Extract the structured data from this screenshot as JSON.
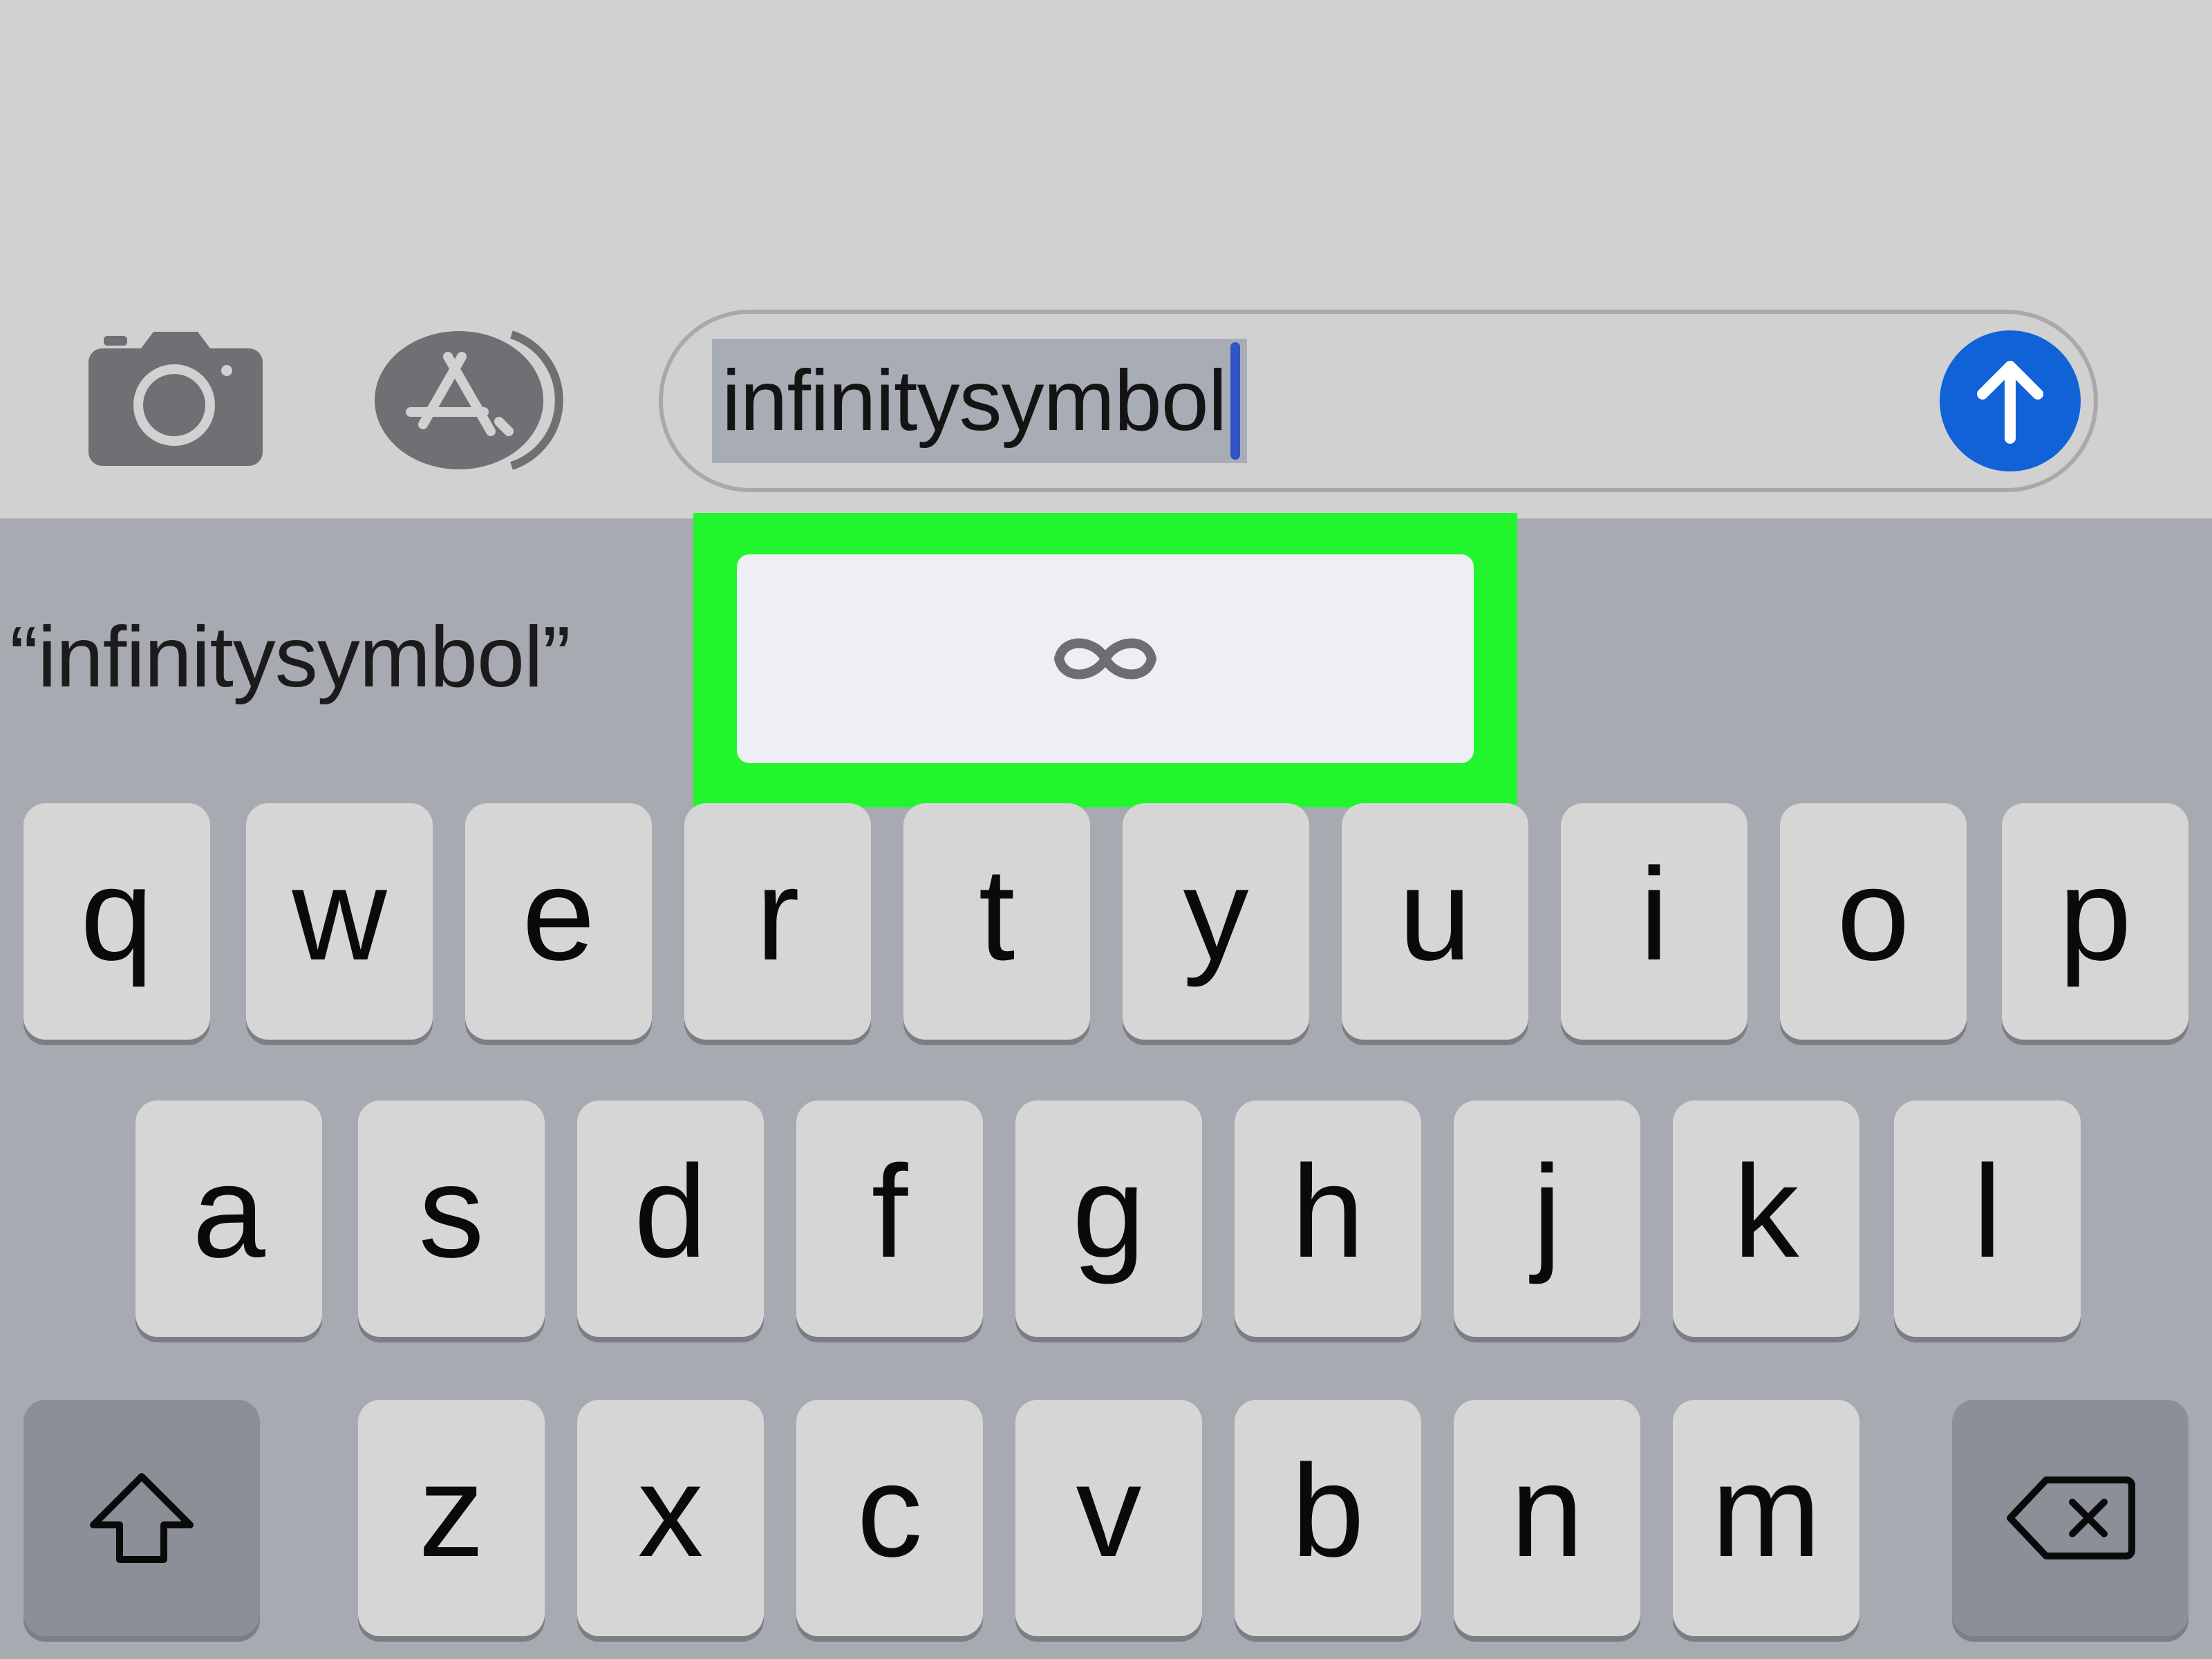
{
  "toolbar": {
    "camera_icon": "camera-icon",
    "appstore_icon": "app-store-icon"
  },
  "message_input": {
    "value": "infinitysymbol",
    "send_icon": "arrow-up-icon"
  },
  "suggestions": {
    "typed_word": "“infinitysymbol”",
    "emoji": "∞"
  },
  "keyboard": {
    "row1": [
      "q",
      "w",
      "e",
      "r",
      "t",
      "y",
      "u",
      "i",
      "o",
      "p"
    ],
    "row2": [
      "a",
      "s",
      "d",
      "f",
      "g",
      "h",
      "j",
      "k",
      "l"
    ],
    "row3": [
      "z",
      "x",
      "c",
      "v",
      "b",
      "n",
      "m"
    ],
    "shift_icon": "shift-icon",
    "delete_icon": "delete-backspace-icon"
  },
  "colors": {
    "send_button": "#1062d6",
    "highlight": "#22f52c"
  }
}
